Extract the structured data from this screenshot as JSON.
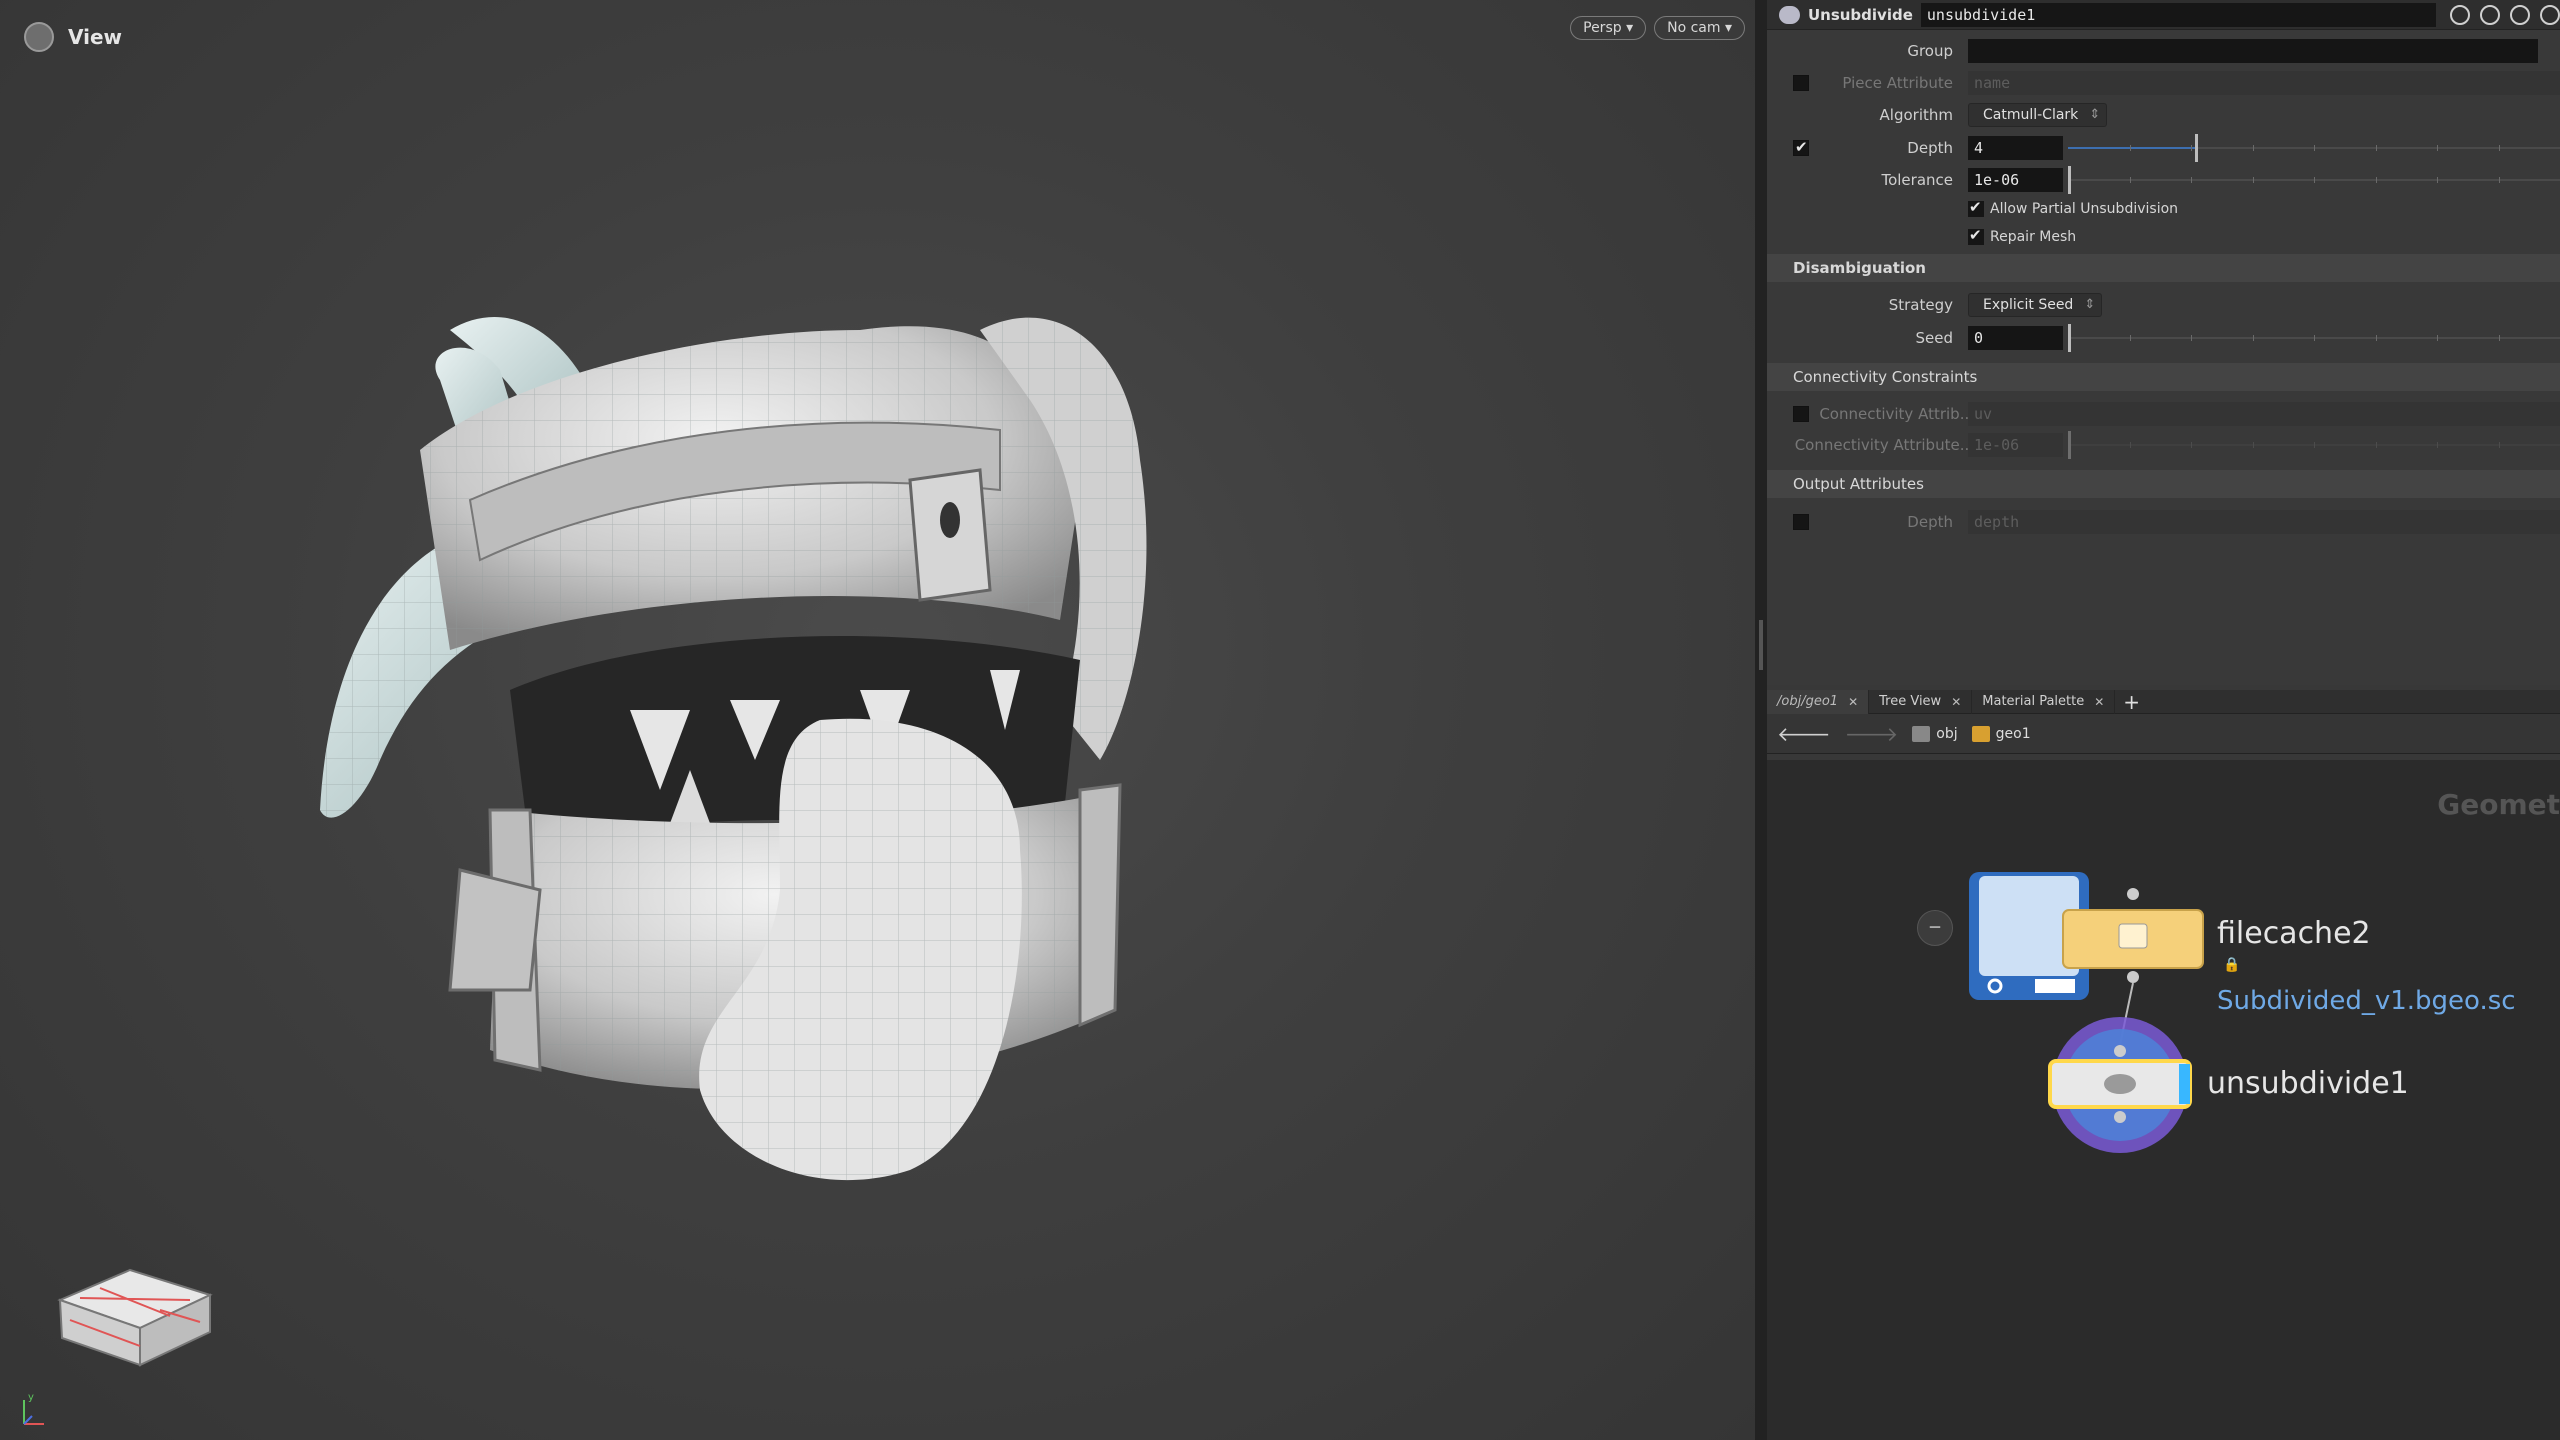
{
  "viewport": {
    "title": "View",
    "persp_label": "Persp ▾",
    "cam_label": "No cam ▾",
    "axis_y": "y"
  },
  "params": {
    "node_type": "Unsubdivide",
    "node_name": "unsubdivide1",
    "rows": {
      "group_label": "Group",
      "group_value": "",
      "piece_label": "Piece Attribute",
      "piece_value": "name",
      "algorithm_label": "Algorithm",
      "algorithm_value": "Catmull-Clark",
      "depth_label": "Depth",
      "depth_value": "4",
      "depth_level": 0.26,
      "tolerance_label": "Tolerance",
      "tolerance_value": "1e-06",
      "partial_label": "Allow Partial Unsubdivision",
      "repair_label": "Repair Mesh"
    },
    "disambiguation": {
      "title": "Disambiguation",
      "strategy_label": "Strategy",
      "strategy_value": "Explicit Seed",
      "seed_label": "Seed",
      "seed_value": "0"
    },
    "connectivity": {
      "title": "Connectivity Constraints",
      "attrib_label": "Connectivity Attrib...",
      "attrib_value": "uv",
      "attrib2_label": "Connectivity Attribute...",
      "attrib2_value": "1e-06"
    },
    "output": {
      "title": "Output Attributes",
      "depth_label": "Depth",
      "depth_value": "depth"
    }
  },
  "tabs": [
    {
      "label": "/obj/geo1"
    },
    {
      "label": "Tree View"
    },
    {
      "label": "Material Palette"
    }
  ],
  "pathbar": {
    "obj": "obj",
    "geo": "geo1"
  },
  "network": {
    "context_label": "Geomet",
    "node1_name": "filecache2",
    "node1_file": "Subdivided_v1.bgeo.sc",
    "node2_name": "unsubdivide1"
  },
  "colors": {
    "accent": "#3d6fb0",
    "filecache": "#f5d07a",
    "selected": "#ffd84a",
    "unsubdivide_ring": "#7a5bd6",
    "link": "#6fa9e6"
  }
}
